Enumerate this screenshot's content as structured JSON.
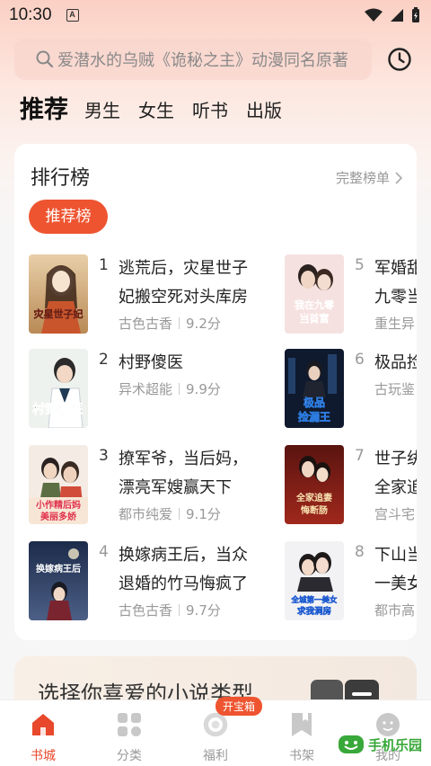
{
  "status_bar": {
    "time": "10:30",
    "notif": "A"
  },
  "search": {
    "placeholder": "爱潜水的乌贼《诡秘之主》动漫同名原著"
  },
  "tabs": [
    "推荐",
    "男生",
    "女生",
    "听书",
    "出版"
  ],
  "ranking": {
    "title": "排行榜",
    "more": "完整榜单",
    "active_pill": "推荐榜",
    "books": [
      {
        "rank": "1",
        "title_l1": "逃荒后，灾星世子",
        "title_l2": "妃搬空死对头库房",
        "genre": "古色古香",
        "score": "9.2分"
      },
      {
        "rank": "2",
        "title_l1": "村野傻医",
        "title_l2": "",
        "genre": "异术超能",
        "score": "9.9分"
      },
      {
        "rank": "3",
        "title_l1": "撩军爷，当后妈，",
        "title_l2": "漂亮军嫂赢天下",
        "genre": "都市纯爱",
        "score": "9.1分"
      },
      {
        "rank": "4",
        "title_l1": "换嫁病王后，当众",
        "title_l2": "退婚的竹马悔疯了",
        "genre": "古色古香",
        "score": "9.7分"
      },
      {
        "rank": "5",
        "title_l1": "军婚甜",
        "title_l2": "九零当",
        "genre": "重生异"
      },
      {
        "rank": "6",
        "title_l1": "极品捡",
        "title_l2": "",
        "genre": "古玩鉴"
      },
      {
        "rank": "7",
        "title_l1": "世子纨",
        "title_l2": "全家追",
        "genre": "宫斗宅"
      },
      {
        "rank": "8",
        "title_l1": "下山当",
        "title_l2": "一美女",
        "genre": "都市高"
      }
    ],
    "cover_text": {
      "c1": "灾星世子妃",
      "c2": "村野傻医",
      "c3a": "小作精后妈",
      "c3b": "美丽多娇",
      "c4": "换嫁病王后",
      "c5a": "我在九零",
      "c5b": "当首富",
      "c6a": "极品",
      "c6b": "捡漏王",
      "c7a": "全家追妻",
      "c7b": "悔断肠",
      "c8a": "全城第一美女",
      "c8b": "求我洞房"
    }
  },
  "genre_banner": {
    "text": "选择你喜爱的小说类型"
  },
  "bottom_nav": [
    {
      "label": "书城",
      "icon": "home-icon"
    },
    {
      "label": "分类",
      "icon": "grid-icon"
    },
    {
      "label": "福利",
      "icon": "gift-icon",
      "badge": "开宝箱"
    },
    {
      "label": "书架",
      "icon": "bookmark-icon"
    },
    {
      "label": "我的",
      "icon": "profile-icon"
    }
  ],
  "watermark": {
    "text": "手机乐园"
  },
  "colors": {
    "accent": "#ee5430",
    "nav_active": "#e8482b"
  }
}
